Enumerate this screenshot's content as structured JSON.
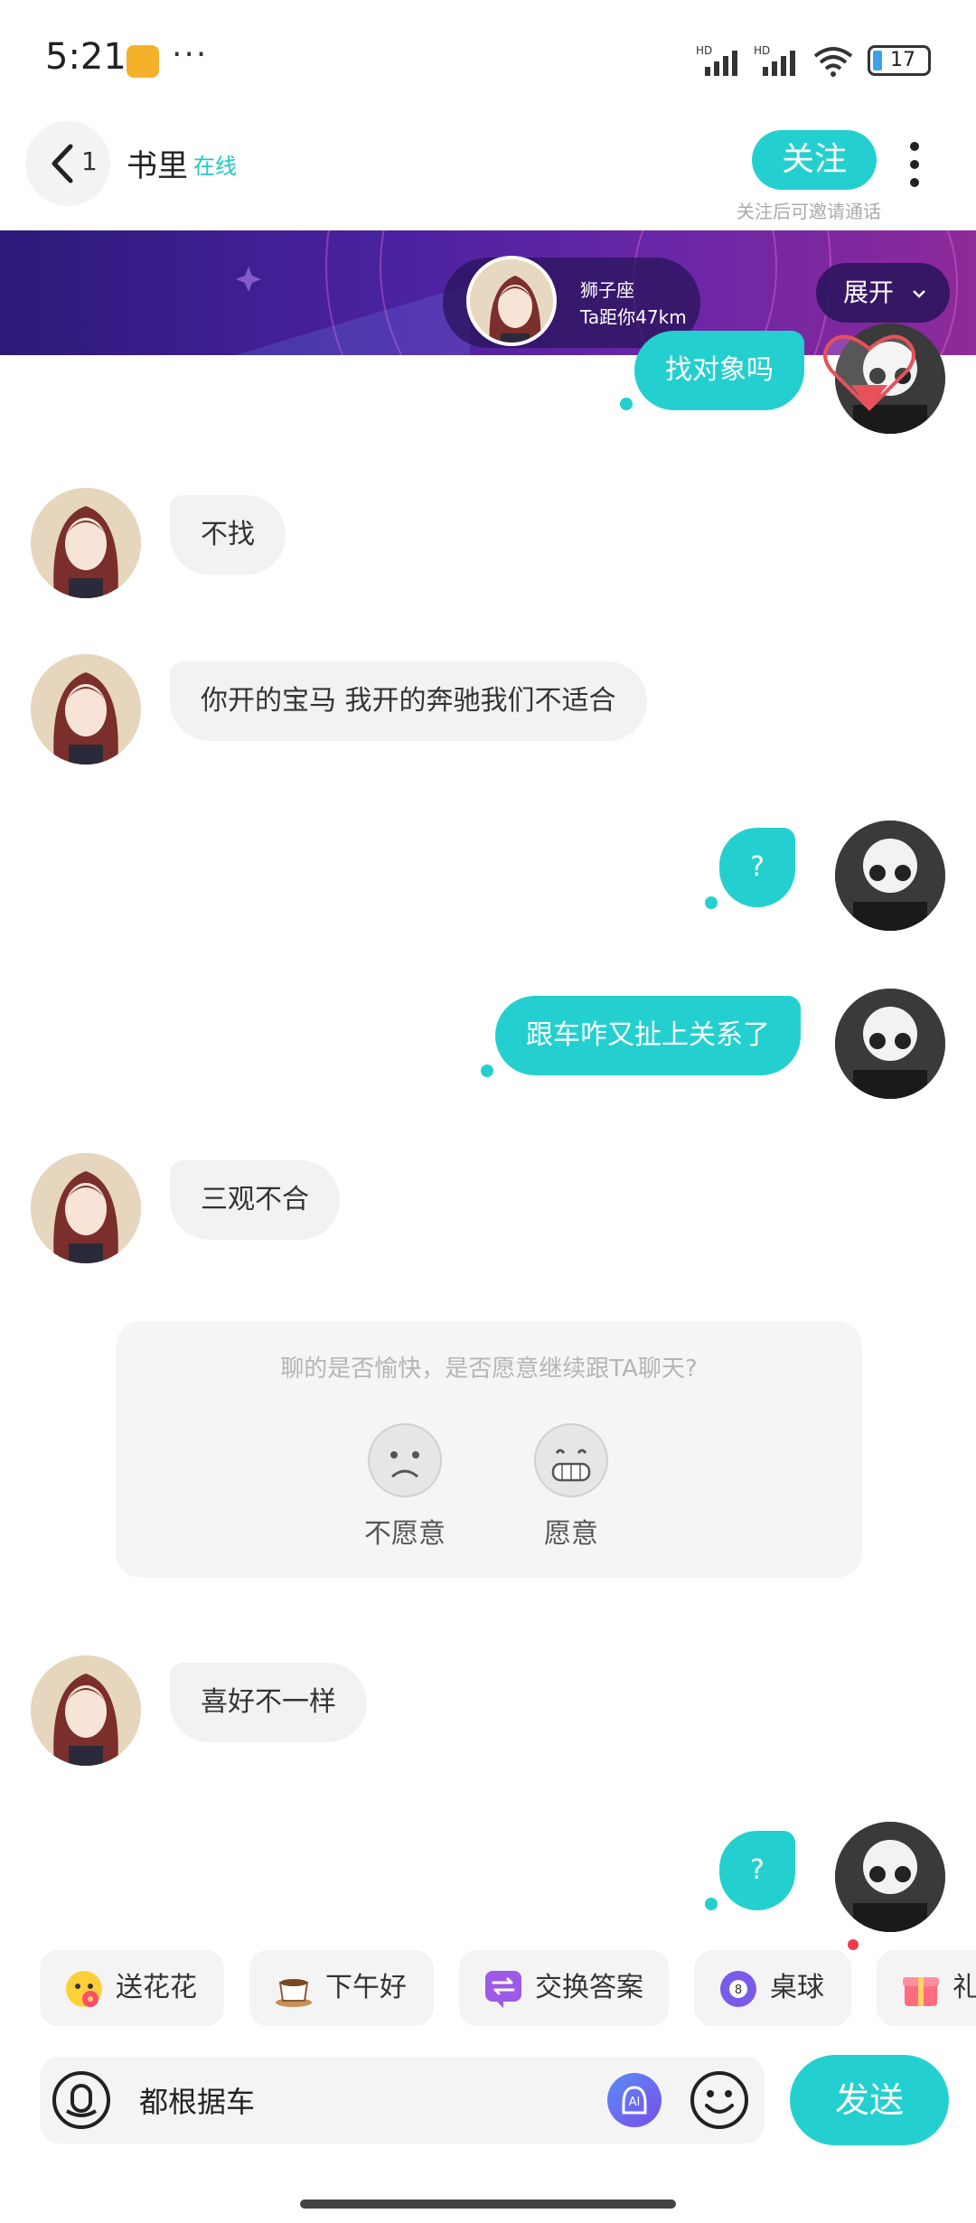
{
  "status_bar": {
    "time": "5:21",
    "dots": "···",
    "network_left": "HD",
    "network_right": "HD",
    "battery": "17"
  },
  "header": {
    "back_count": "1",
    "contact_name": "书里",
    "online_status": "在线",
    "follow_label": "关注",
    "follow_hint": "关注后可邀请通话"
  },
  "banner": {
    "zodiac": "狮子座",
    "distance": "Ta距你47km",
    "expand_label": "展开"
  },
  "messages": [
    {
      "side": "right",
      "text": "找对象吗"
    },
    {
      "side": "left",
      "text": "不找"
    },
    {
      "side": "left",
      "text": "你开的宝马 我开的奔驰我们不适合"
    },
    {
      "side": "right",
      "text": "?"
    },
    {
      "side": "right",
      "text": "跟车咋又扯上关系了"
    },
    {
      "side": "left",
      "text": "三观不合"
    },
    {
      "side": "left",
      "text": "喜好不一样"
    },
    {
      "side": "right",
      "text": "?"
    }
  ],
  "feedback": {
    "question": "聊的是否愉快，是否愿意继续跟TA聊天?",
    "option_no": "不愿意",
    "option_yes": "愿意"
  },
  "quick_replies": [
    {
      "label": "送花花",
      "icon": "flower-emoji-icon"
    },
    {
      "label": "下午好",
      "icon": "coffee-icon"
    },
    {
      "label": "交换答案",
      "icon": "exchange-icon"
    },
    {
      "label": "桌球",
      "icon": "billiard-ball-icon"
    },
    {
      "label": "礼",
      "icon": "gift-icon"
    }
  ],
  "input": {
    "value": "都根据车",
    "send_label": "发送"
  },
  "colors": {
    "accent": "#24d0cf",
    "bubble_left": "#f2f2f2",
    "banner_start": "#2c1a7a",
    "banner_end": "#8e2a9a"
  }
}
